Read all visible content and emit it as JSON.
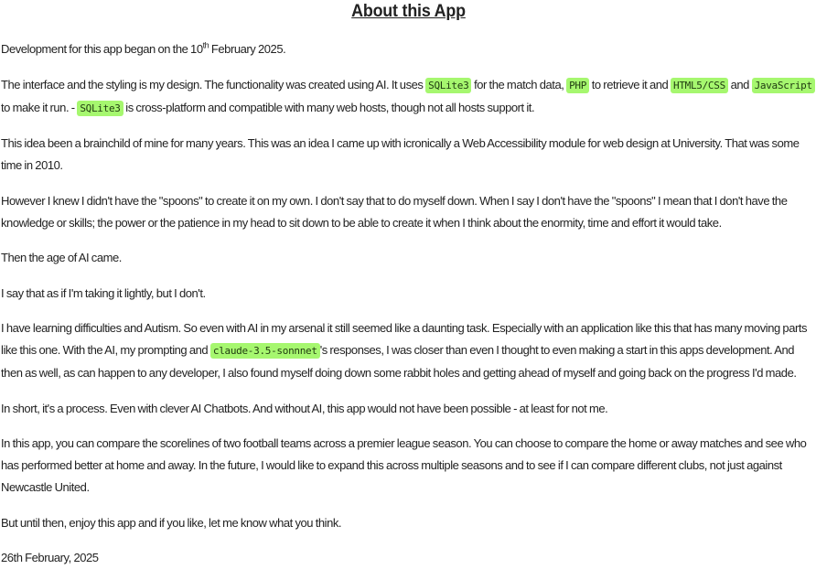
{
  "title": "About this App",
  "intro": {
    "prefix": "Development for this app began on the 10",
    "sup": "th",
    "suffix": " February 2025."
  },
  "tech": {
    "t1": "The interface and the styling is my design. The functionality was created using AI. It uses ",
    "code_sqlite": "SQLite3",
    "t2": " for the match data, ",
    "code_php": "PHP",
    "t3": " to retrieve it and ",
    "code_html": "HTML5/CSS",
    "t4": " and ",
    "code_js": "JavaScript",
    "t5": " to make it run. - ",
    "code_sqlite2": "SQLite3",
    "t6": " is cross-platform and compatible with many web hosts, though not all hosts support it."
  },
  "p_idea": "This idea been a brainchild of mine for many years. This was an idea I came up with icronically a Web Accessibility module for web design at University. That was some time in 2010.",
  "p_spoons": "However I knew I didn't have the \"spoons\" to create it on my own. I don't say that to do myself down. When I say I don't have the \"spoons\" I mean that I don't have the knowledge or skills; the power or the patience in my head to sit down to be able to create it when I think about the enormity, time and effort it would take.",
  "p_age": "Then the age of AI came.",
  "p_lightly": "I say that as if I'm taking it lightly, but I don't.",
  "learning": {
    "t1": "I have learning difficulties and Autism. So even with AI in my arsenal it still seemed like a daunting task. Especially with an application like this that has many moving parts like this one. With the AI, my prompting and ",
    "code_model": "claude-3.5-sonnnet",
    "t2": "'s responses, I was closer than even I thought to even making a start in this apps development. And then as well, as can happen to any developer, I also found myself doing down some rabbit holes and getting ahead of myself and going back on the progress I'd made."
  },
  "p_short": "In short, it's a process. Even with clever AI Chatbots. And without AI, this app would not have been possible - at least for not me.",
  "p_compare": "In this app, you can compare the scorelines of two football teams across a premier league season. You can choose to compare the home or away matches and see who has performed better at home and away. In the future, I would like to expand this across multiple seasons and to see if I can compare different clubs, not just against Newcastle United.",
  "p_enjoy": "But until then, enjoy this app and if you like, let me know what you think.",
  "date": "26th February, 2025",
  "colors": {
    "code_highlight": "#a6f76f",
    "text": "#222222"
  }
}
